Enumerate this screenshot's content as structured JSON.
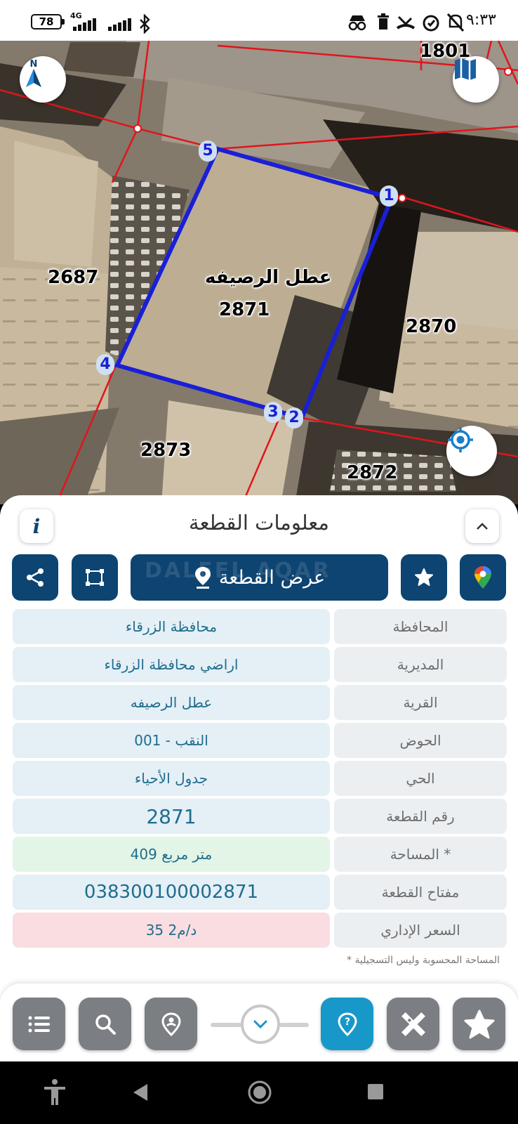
{
  "status_bar": {
    "battery": "78",
    "network": "4G",
    "time": "٩:٣٣"
  },
  "map": {
    "parcel_village_label": "عطل الرصيفه",
    "selected_parcel_number": "2871",
    "neighbor_parcels": [
      "1801",
      "2687",
      "2870",
      "2873",
      "2872"
    ],
    "vertices": [
      "5",
      "1",
      "4",
      "3",
      "2"
    ],
    "buttons": {
      "north": "north-arrow-icon",
      "layers": "map-icon",
      "locate": "locate-icon"
    }
  },
  "sheet": {
    "title": "معلومات القطعة",
    "show_parcel_button": "عرض القطعة",
    "watermark": "DALEEL AQAR",
    "rows": [
      {
        "key": "المحافظة",
        "value": "محافظة الزرقاء",
        "style": "normal"
      },
      {
        "key": "المديرية",
        "value": "اراضي محافظة الزرقاء",
        "style": "normal"
      },
      {
        "key": "القرية",
        "value": "عطل الرصيفه",
        "style": "normal"
      },
      {
        "key": "الحوض",
        "value": "النقب - 001",
        "style": "normal"
      },
      {
        "key": "الحي",
        "value": "جدول الأحياء",
        "style": "normal"
      },
      {
        "key": "رقم القطعة",
        "value": "2871",
        "style": "big"
      },
      {
        "key": "المساحة *",
        "value": "409  متر مربع",
        "style": "green"
      },
      {
        "key": "مفتاح القطعة",
        "value": "038300100002871",
        "style": "big"
      },
      {
        "key": "السعر الإداري",
        "value": "35 د/م2",
        "style": "red"
      }
    ],
    "footnote": "* المساحة المحسوبة وليس التسجيلية"
  },
  "colors": {
    "primary": "#0d4471",
    "accent": "#1798c9",
    "value_text": "#1f6d8d",
    "row_blue": "#e4eff6",
    "row_green": "#e3f5e6",
    "row_red": "#f9dde0",
    "parcel_outline": "#1a1fd6",
    "boundary": "#e0151b"
  }
}
